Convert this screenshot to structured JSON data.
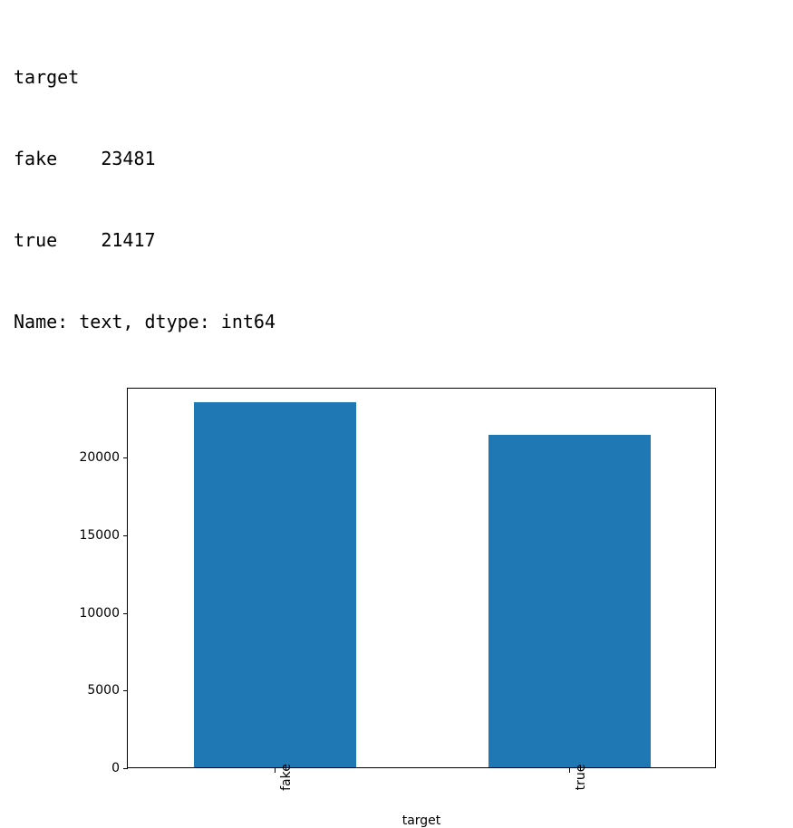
{
  "text_output": {
    "line1": "target",
    "line2": "fake    23481",
    "line3": "true    21417",
    "line4": "Name: text, dtype: int64"
  },
  "chart_data": {
    "type": "bar",
    "categories": [
      "fake",
      "true"
    ],
    "values": [
      23481,
      21417
    ],
    "xlabel": "target",
    "ylabel": "",
    "ylim": [
      0,
      24500
    ],
    "y_ticks": [
      0,
      5000,
      10000,
      15000,
      20000
    ],
    "bar_color": "#1f77b4"
  }
}
